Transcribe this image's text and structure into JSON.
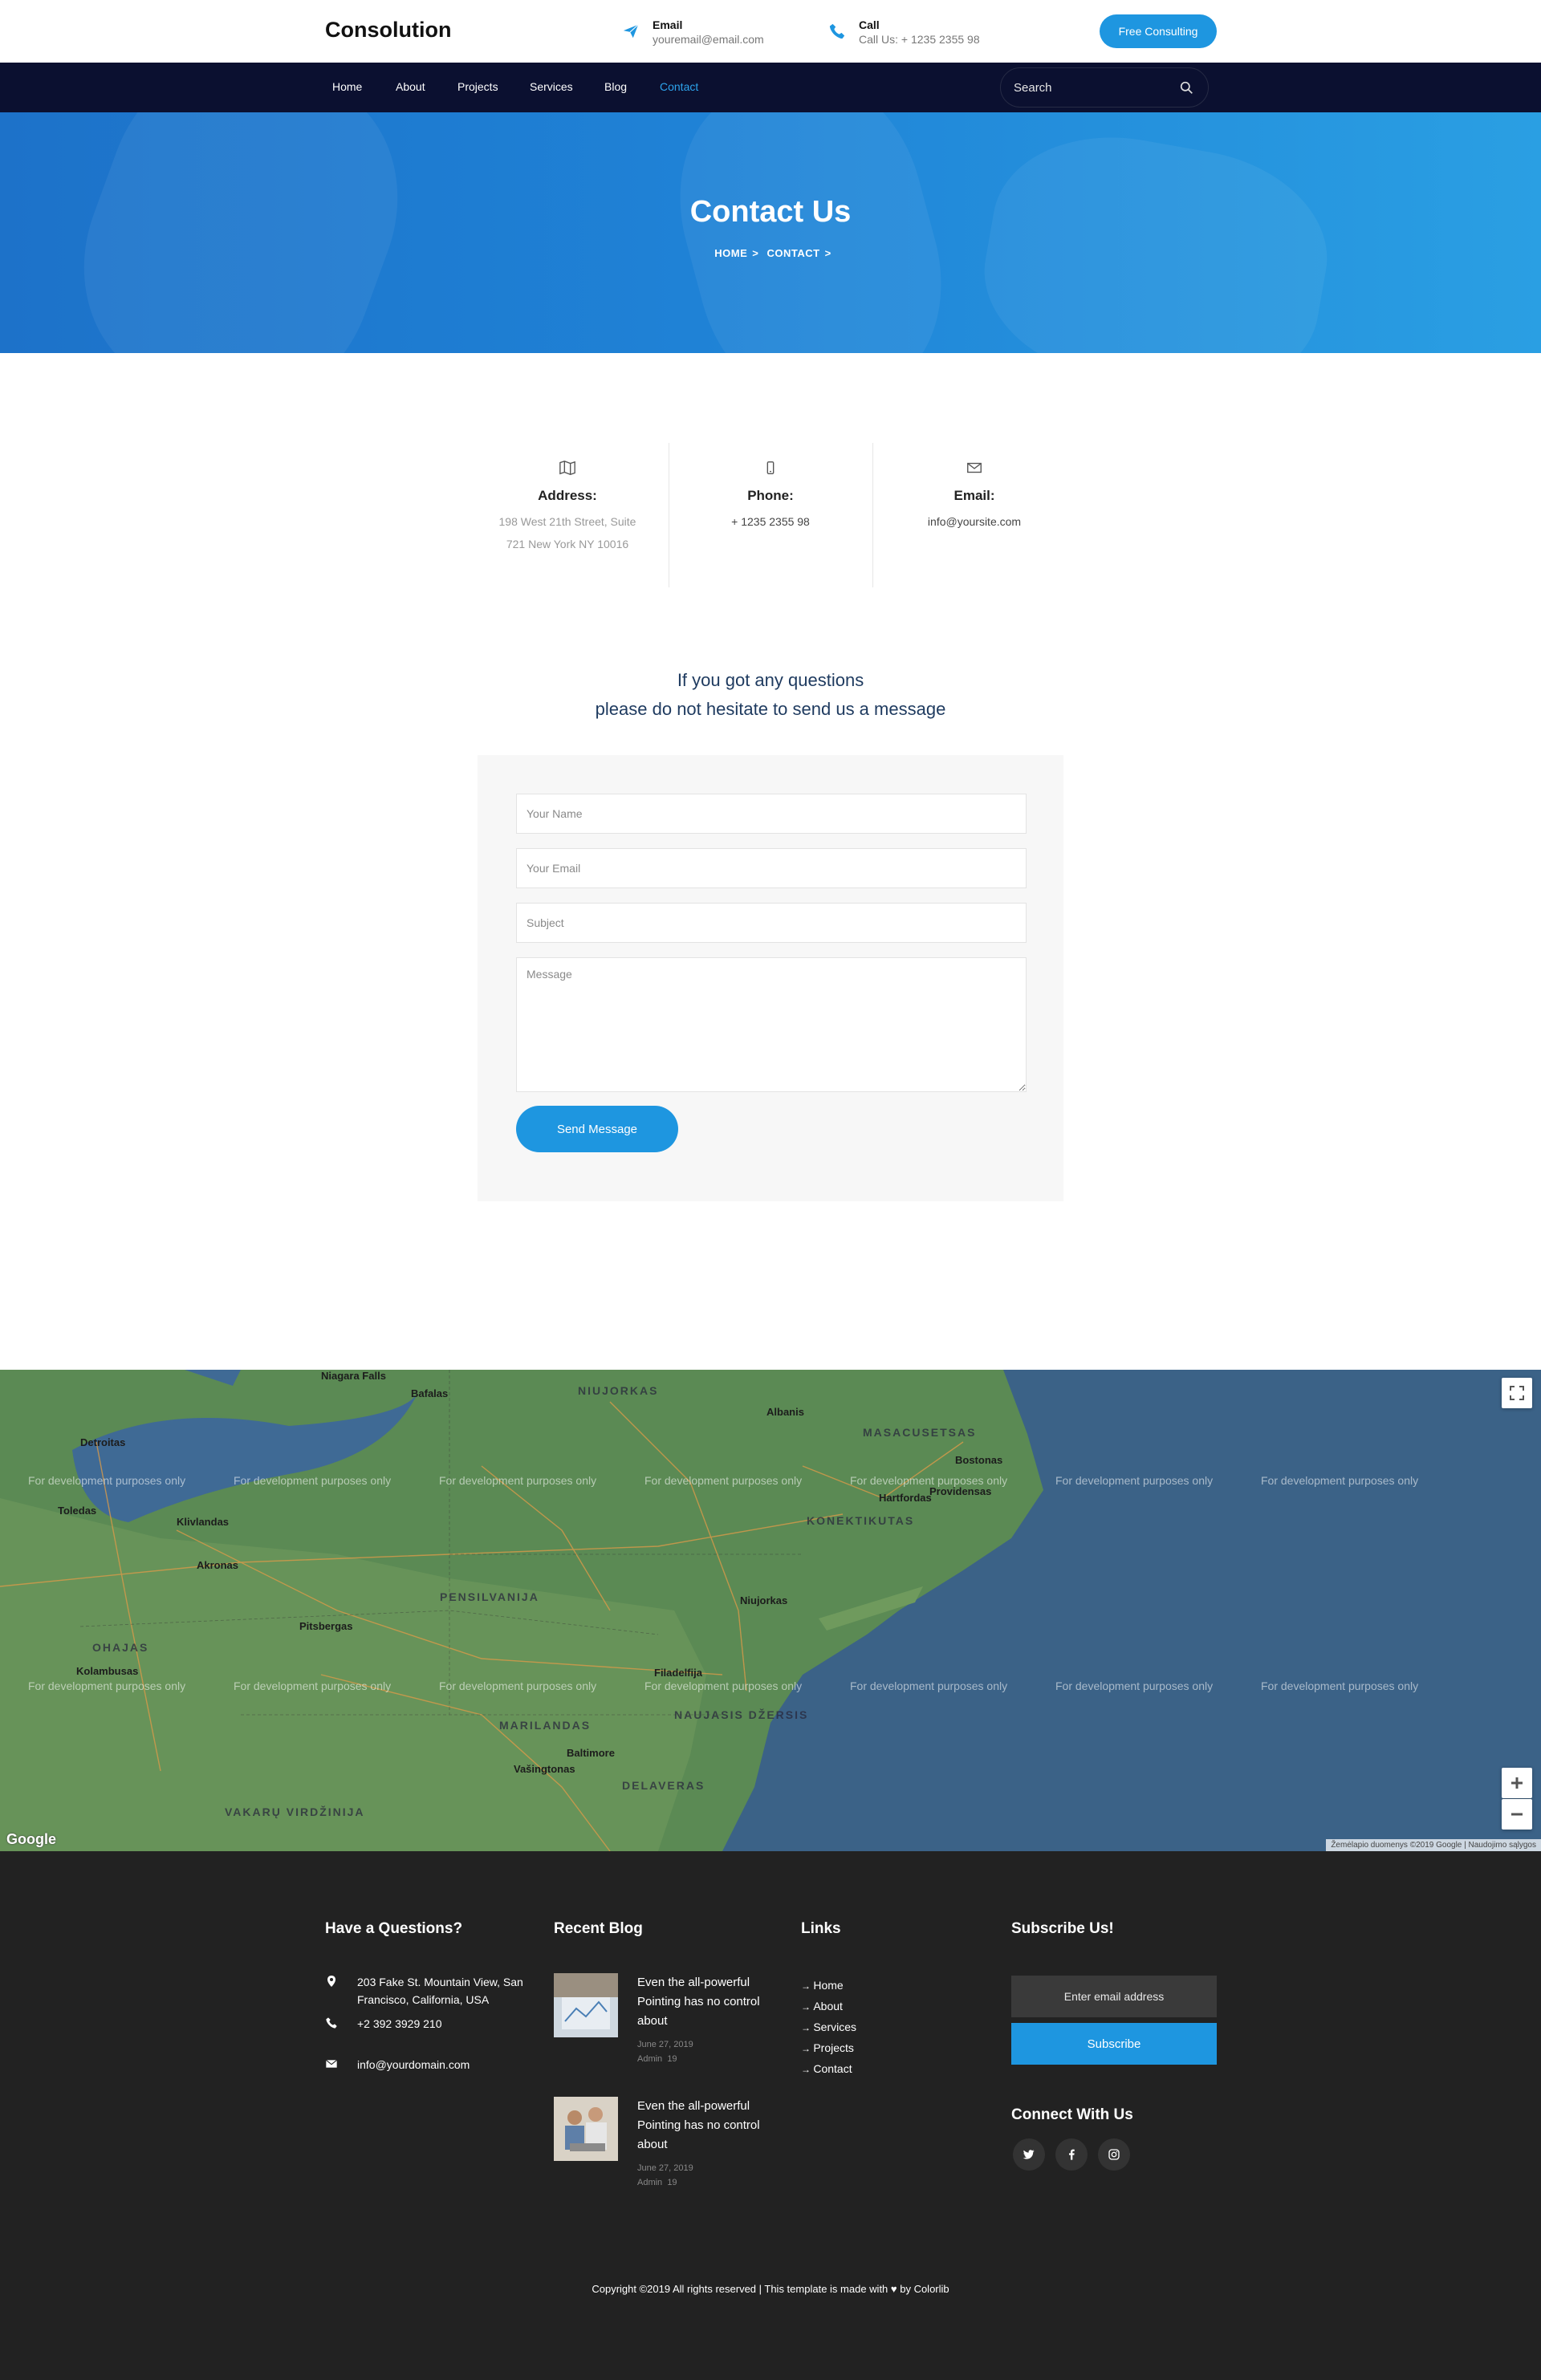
{
  "header": {
    "brand": "Consolution",
    "email_label": "Email",
    "email_value": "youremail@email.com",
    "call_label": "Call",
    "call_value": "Call Us: + 1235 2355 98",
    "cta_label": "Free Consulting"
  },
  "nav": {
    "items": [
      "Home",
      "About",
      "Projects",
      "Services",
      "Blog",
      "Contact"
    ],
    "active": "Contact",
    "search_placeholder": "Search"
  },
  "hero": {
    "title": "Contact Us",
    "breadcrumb": [
      "HOME",
      "CONTACT"
    ]
  },
  "contact_info": {
    "address_label": "Address:",
    "address_line1": "198 West 21th Street, Suite",
    "address_line2": "721 New York NY 10016",
    "phone_label": "Phone:",
    "phone_value": "+ 1235 2355 98",
    "email_label": "Email:",
    "email_value": "info@yoursite.com"
  },
  "message": {
    "line1": "If you got any questions",
    "line2": "please do not hesitate to send us a message"
  },
  "form": {
    "name_placeholder": "Your Name",
    "email_placeholder": "Your Email",
    "subject_placeholder": "Subject",
    "message_placeholder": "Message",
    "submit_label": "Send Message"
  },
  "map": {
    "watermark": "For development purposes only",
    "labels": {
      "niagara": "Niagara Falls",
      "bafalas": "Bafalas",
      "niujorkas_state": "NIUJORKAS",
      "albanis": "Albanis",
      "masacusetsas": "MASACUSETSAS",
      "bostonas": "Bostonas",
      "detroitas": "Detroitas",
      "klivlandas": "Klivlandas",
      "toledas": "Toledas",
      "akronas": "Akronas",
      "pensilvanija": "PENSILVANIJA",
      "pitsbergas": "Pitsbergas",
      "konektikutas": "KONEKTIKUTAS",
      "hartfordas": "Hartfordas",
      "providensas": "Providensas",
      "niujorkas": "Niujorkas",
      "filadelfija": "Filadelfija",
      "ohajas": "OHAJAS",
      "kolambusas": "Kolambusas",
      "marilandas": "MARILANDAS",
      "baltimore": "Baltimore",
      "vasingtonas": "Vašingtonas",
      "delaveras": "DELAVERAS",
      "naujasis_dzersis": "NAUJASIS DŽERSIS",
      "vakaru_virdzinija": "VAKARŲ VIRDŽINIJA"
    },
    "google": "Google",
    "terms": "Žemėlapio duomenys ©2019 Google  |  Naudojimo sąlygos"
  },
  "footer": {
    "questions_title": "Have a Questions?",
    "address": "203 Fake St. Mountain View, San Francisco, California, USA",
    "phone": "+2 392 3929 210",
    "email": "info@yourdomain.com",
    "blog_title": "Recent Blog",
    "posts": [
      {
        "title": "Even the all-powerful Pointing has no control about",
        "date": "June 27, 2019",
        "author": "Admin",
        "comments": "19"
      },
      {
        "title": "Even the all-powerful Pointing has no control about",
        "date": "June 27, 2019",
        "author": "Admin",
        "comments": "19"
      }
    ],
    "links_title": "Links",
    "links": [
      "Home",
      "About",
      "Services",
      "Projects",
      "Contact"
    ],
    "subscribe_title": "Subscribe Us!",
    "subscribe_placeholder": "Enter email address",
    "subscribe_button": "Subscribe",
    "connect_title": "Connect With Us",
    "copyright": "Copyright ©2019 All rights reserved | This template is made with ♥ by Colorlib"
  },
  "colors": {
    "accent": "#1e96e0",
    "nav_bg": "#0b1030",
    "footer_bg": "#222222",
    "hero_blue": "#1f82d6"
  }
}
